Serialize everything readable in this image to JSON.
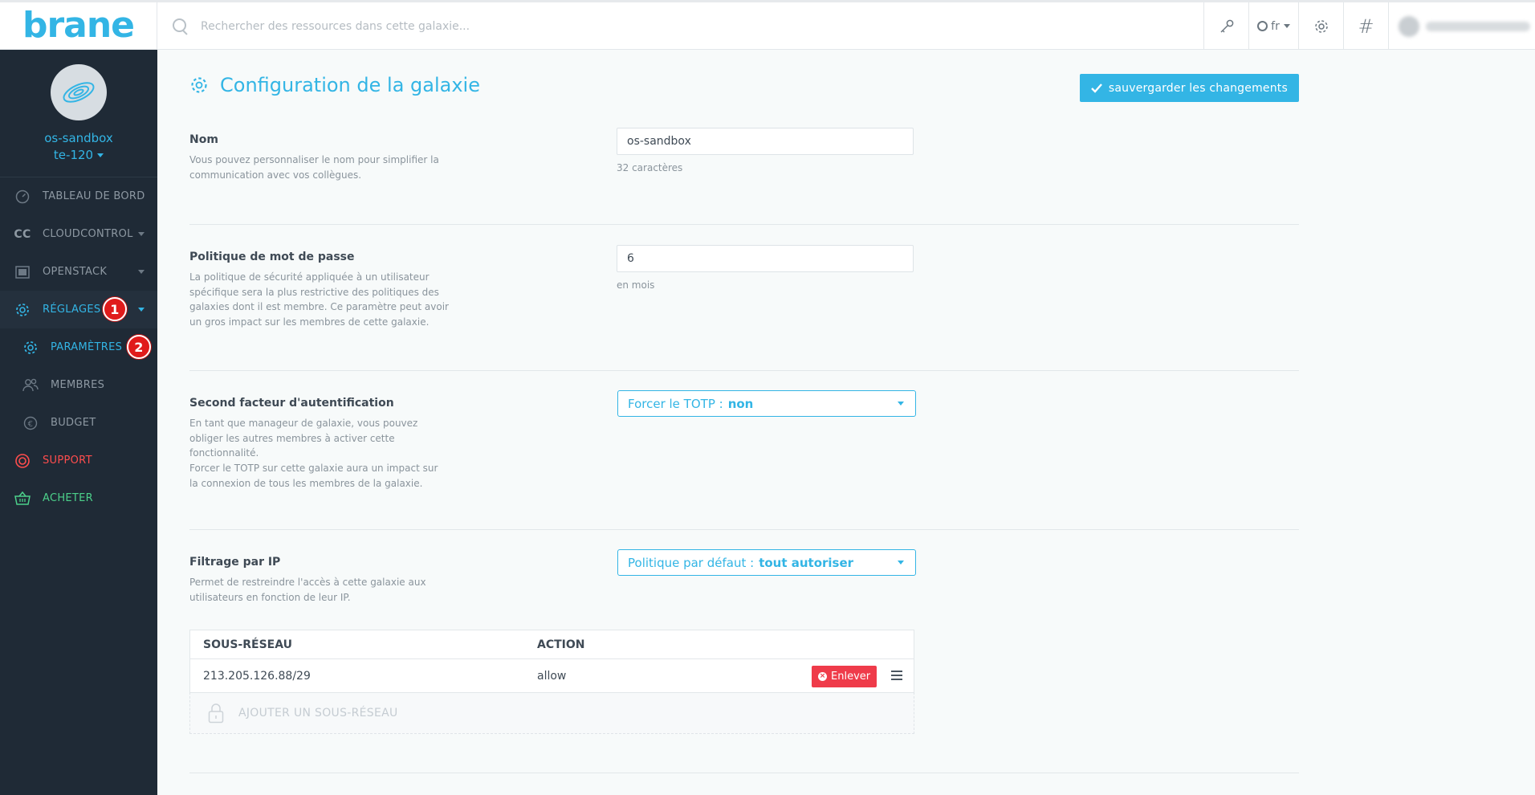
{
  "topbar": {
    "logo": "brane",
    "search_placeholder": "Rechercher des ressources dans cette galaxie...",
    "language": "fr"
  },
  "sidebar": {
    "galaxy_name": "os-sandbox",
    "galaxy_id": "te-120",
    "items": [
      {
        "label": "Tableau de bord",
        "icon": "dashboard-icon"
      },
      {
        "label": "CC",
        "icon": "cc-icon"
      },
      {
        "label": "Cloudcontrol",
        "icon": "cc-icon"
      },
      {
        "label": "Openstack",
        "icon": "server-icon"
      },
      {
        "label": "Réglages",
        "icon": "gear-icon"
      },
      {
        "label": "Paramètres",
        "icon": "gear-icon"
      },
      {
        "label": "Membres",
        "icon": "users-icon"
      },
      {
        "label": "Budget",
        "icon": "euro-icon"
      },
      {
        "label": "Support",
        "icon": "lifebuoy-icon"
      },
      {
        "label": "Acheter",
        "icon": "basket-icon"
      }
    ],
    "markers": [
      "1",
      "2"
    ]
  },
  "page": {
    "title": "Configuration de la galaxie",
    "save_label": "sauvergarder les changements"
  },
  "sections": {
    "name": {
      "title": "Nom",
      "description": "Vous pouvez personnaliser le nom pour simplifier la communication avec vos collègues.",
      "value": "os-sandbox",
      "help": "32 caractères"
    },
    "password": {
      "title": "Politique de mot de passe",
      "description": "La politique de sécurité appliquée à un utilisateur spécifique sera la plus restrictive des politiques des galaxies dont il est membre. Ce paramètre peut avoir un gros impact sur les membres de cette galaxie.",
      "value": "6",
      "help": "en mois"
    },
    "twofa": {
      "title": "Second facteur d'autentification",
      "description_1": "En tant que manageur de galaxie, vous pouvez obliger les autres membres à activer cette fonctionnalité.",
      "description_2": "Forcer le TOTP sur cette galaxie aura un impact sur la connexion de tous les membres de la galaxie.",
      "select_label": "Forcer le TOTP :",
      "select_value": "non"
    },
    "ipfilter": {
      "title": "Filtrage par IP",
      "description": "Permet de restreindre l'accès à cette galaxie aux utilisateurs en fonction de leur IP.",
      "select_label": "Politique par défaut :",
      "select_value": "tout autoriser",
      "table": {
        "columns": [
          "Sous-réseau",
          "Action"
        ],
        "rows": [
          {
            "subnet": "213.205.126.88/29",
            "action": "allow",
            "remove_label": "Enlever"
          }
        ],
        "add_label": "Ajouter un sous-réseau"
      }
    }
  },
  "colors": {
    "accent": "#33b5e5",
    "sidebar_bg": "#1f2a36",
    "danger": "#ef3b4a",
    "support": "#ff4d4d",
    "buy": "#4cd08a",
    "marker": "#e01b1b"
  }
}
